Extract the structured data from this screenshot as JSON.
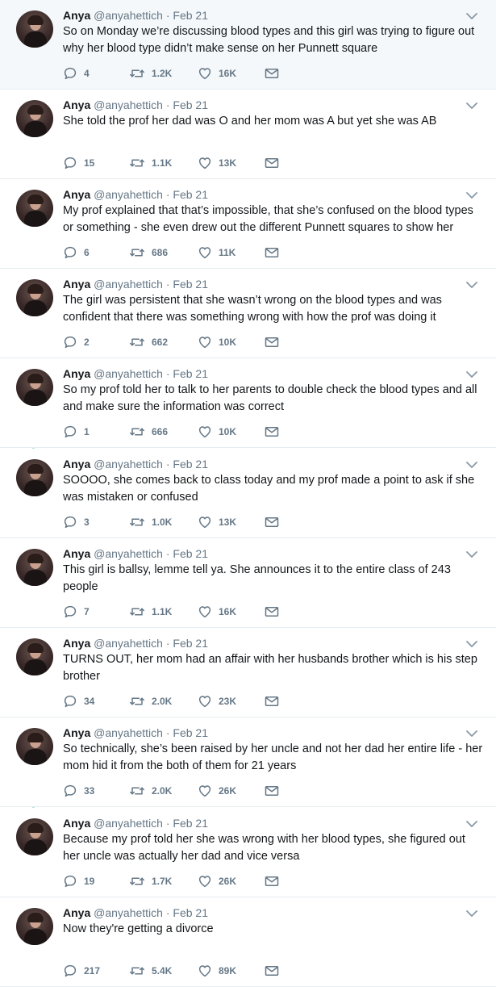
{
  "author": {
    "name": "Anya",
    "handle": "@anyahettich",
    "separator": "·"
  },
  "tweets": [
    {
      "date": "Feb 21",
      "text": "So on Monday we’re discussing blood types and this girl was trying to figure out why her blood type didn’t make sense on her Punnett square",
      "replies": "4",
      "retweets": "1.2K",
      "likes": "16K"
    },
    {
      "date": "Feb 21",
      "text": "She told the prof her dad was O and her mom was A but yet she was AB",
      "replies": "15",
      "retweets": "1.1K",
      "likes": "13K"
    },
    {
      "date": "Feb 21",
      "text": "My prof explained that that’s impossible, that she’s confused on the blood types or something - she even drew out the different Punnett squares to show her",
      "replies": "6",
      "retweets": "686",
      "likes": "11K"
    },
    {
      "date": "Feb 21",
      "text": "The girl was persistent that she wasn’t wrong on the blood types and was confident that there was something wrong with how the prof was doing it",
      "replies": "2",
      "retweets": "662",
      "likes": "10K"
    },
    {
      "date": "Feb 21",
      "text": "So my prof told her to talk to her parents to double check the blood types and all and make sure the information was correct",
      "replies": "1",
      "retweets": "666",
      "likes": "10K"
    },
    {
      "date": "Feb 21",
      "text": "SOOOO, she comes back to class today and my prof made a point to ask if she was mistaken or confused",
      "replies": "3",
      "retweets": "1.0K",
      "likes": "13K"
    },
    {
      "date": "Feb 21",
      "text": "This girl is ballsy, lemme tell ya. She announces it to the entire class of 243 people",
      "replies": "7",
      "retweets": "1.1K",
      "likes": "16K"
    },
    {
      "date": "Feb 21",
      "text": "TURNS OUT, her mom had an affair with her husbands brother which is his step brother",
      "replies": "34",
      "retweets": "2.0K",
      "likes": "23K"
    },
    {
      "date": "Feb 21",
      "text": "So technically, she’s been raised by her uncle and not her dad her entire life - her mom hid it from the both of them for 21 years",
      "replies": "33",
      "retweets": "2.0K",
      "likes": "26K"
    },
    {
      "date": "Feb 21",
      "text": "Because my prof told her she was wrong with her blood types, she figured out her uncle was actually her dad and vice versa",
      "replies": "19",
      "retweets": "1.7K",
      "likes": "26K"
    },
    {
      "date": "Feb 21",
      "text": "Now they're getting a divorce",
      "replies": "217",
      "retweets": "5.4K",
      "likes": "89K"
    }
  ],
  "icons": {
    "reply": "reply-icon",
    "retweet": "retweet-icon",
    "like": "like-icon",
    "dm": "direct-message-icon",
    "menu": "chevron-down-icon"
  },
  "colors": {
    "text": "#14171a",
    "secondary": "#657786",
    "thread_line": "#b8e0e3",
    "highlight_bg": "#f5f8fa",
    "divider": "#e6ecf0"
  }
}
